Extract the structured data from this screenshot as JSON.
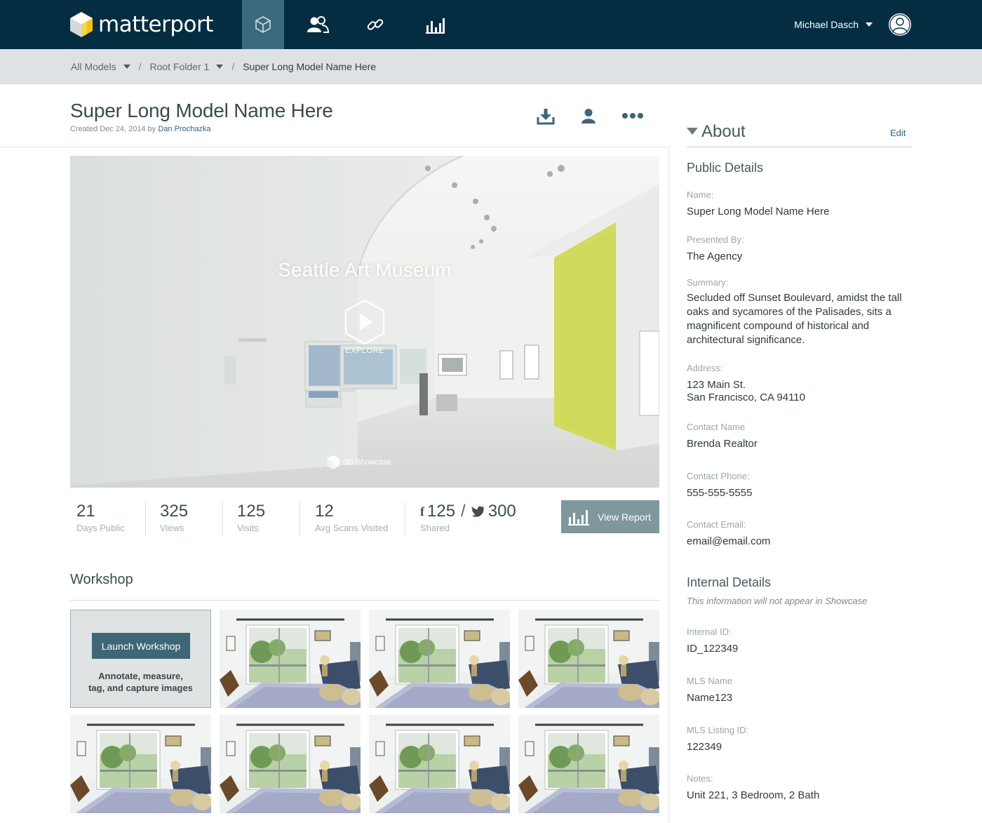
{
  "nav": {
    "brand": "matterport",
    "tabs": [
      "models",
      "users",
      "links",
      "analytics"
    ],
    "user_name": "Michael Dasch"
  },
  "breadcrumb": {
    "items": [
      "All Models",
      "Root Folder 1"
    ],
    "current": "Super Long Model Name Here",
    "separator": "/"
  },
  "model": {
    "title": "Super Long Model Name Here",
    "created_prefix": "Created Dec 24, 2014 by",
    "author": "Dan Prochazka"
  },
  "hero": {
    "title": "Seattle Art Museum",
    "explore_label": "EXPLORE",
    "badge": "3D Showcase"
  },
  "stats": [
    {
      "value": "21",
      "label": "Days Public"
    },
    {
      "value": "325",
      "label": "Views"
    },
    {
      "value": "125",
      "label": "Visits"
    },
    {
      "value": "12",
      "label": "Avg Scans Visited"
    }
  ],
  "share": {
    "facebook_icon": "f",
    "facebook": "125",
    "separator": "/",
    "twitter": "300",
    "label": "Shared"
  },
  "view_report": "View Report",
  "workshop": {
    "title": "Workshop",
    "launch_label": "Launch Workshop",
    "description_line1": "Annotate, measure,",
    "description_line2": "tag, and capture images",
    "thumbnail_count": 7
  },
  "about": {
    "title": "About",
    "edit": "Edit",
    "public_title": "Public  Details",
    "name_label": "Name:",
    "name_value": "Super Long Model Name Here",
    "presented_label": "Presented By:",
    "presented_value": "The Agency",
    "summary_label": "Summary:",
    "summary_value": "Secluded off Sunset Boulevard, amidst the tall oaks and sycamores of the Palisades, sits a magnificent compound of  historical and architectural significance.",
    "address_label": "Address:",
    "address_line1": "123 Main St.",
    "address_line2": "San Francisco, CA 94110",
    "contact_name_label": "Contact Name",
    "contact_name_value": "Brenda Realtor",
    "contact_phone_label": "Contact Phone:",
    "contact_phone_value": "555-555-5555",
    "contact_email_label": "Contact Email:",
    "contact_email_value": "email@email.com",
    "internal_title": "Internal Details",
    "internal_note": "This information will not appear in Showcase",
    "internal_id_label": "Internal  ID:",
    "internal_id_value": "ID_122349",
    "mls_name_label": "MLS Name",
    "mls_name_value": "Name123",
    "mls_listing_label": "MLS  Listing ID:",
    "mls_listing_value": "122349",
    "notes_label": "Notes:",
    "notes_value": "Unit 221, 3 Bedroom, 2 Bath"
  },
  "colors": {
    "topbar": "#042d42",
    "active_tab": "#3b6a7c",
    "link": "#2b6482",
    "report_button": "#7f979e",
    "workshop_button": "#3d6676"
  },
  "icons": {
    "download": "download-icon",
    "share_user": "user-icon",
    "more": "more-icon",
    "chart": "bar-chart-icon"
  }
}
